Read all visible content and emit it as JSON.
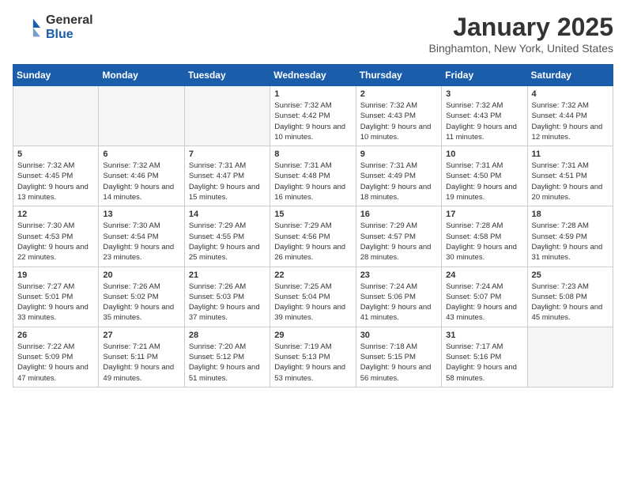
{
  "header": {
    "logo_general": "General",
    "logo_blue": "Blue",
    "title": "January 2025",
    "location": "Binghamton, New York, United States"
  },
  "weekdays": [
    "Sunday",
    "Monday",
    "Tuesday",
    "Wednesday",
    "Thursday",
    "Friday",
    "Saturday"
  ],
  "weeks": [
    [
      {
        "day": "",
        "empty": true
      },
      {
        "day": "",
        "empty": true
      },
      {
        "day": "",
        "empty": true
      },
      {
        "day": "1",
        "sunrise": "7:32 AM",
        "sunset": "4:42 PM",
        "daylight": "9 hours and 10 minutes."
      },
      {
        "day": "2",
        "sunrise": "7:32 AM",
        "sunset": "4:43 PM",
        "daylight": "9 hours and 10 minutes."
      },
      {
        "day": "3",
        "sunrise": "7:32 AM",
        "sunset": "4:43 PM",
        "daylight": "9 hours and 11 minutes."
      },
      {
        "day": "4",
        "sunrise": "7:32 AM",
        "sunset": "4:44 PM",
        "daylight": "9 hours and 12 minutes."
      }
    ],
    [
      {
        "day": "5",
        "sunrise": "7:32 AM",
        "sunset": "4:45 PM",
        "daylight": "9 hours and 13 minutes."
      },
      {
        "day": "6",
        "sunrise": "7:32 AM",
        "sunset": "4:46 PM",
        "daylight": "9 hours and 14 minutes."
      },
      {
        "day": "7",
        "sunrise": "7:31 AM",
        "sunset": "4:47 PM",
        "daylight": "9 hours and 15 minutes."
      },
      {
        "day": "8",
        "sunrise": "7:31 AM",
        "sunset": "4:48 PM",
        "daylight": "9 hours and 16 minutes."
      },
      {
        "day": "9",
        "sunrise": "7:31 AM",
        "sunset": "4:49 PM",
        "daylight": "9 hours and 18 minutes."
      },
      {
        "day": "10",
        "sunrise": "7:31 AM",
        "sunset": "4:50 PM",
        "daylight": "9 hours and 19 minutes."
      },
      {
        "day": "11",
        "sunrise": "7:31 AM",
        "sunset": "4:51 PM",
        "daylight": "9 hours and 20 minutes."
      }
    ],
    [
      {
        "day": "12",
        "sunrise": "7:30 AM",
        "sunset": "4:53 PM",
        "daylight": "9 hours and 22 minutes."
      },
      {
        "day": "13",
        "sunrise": "7:30 AM",
        "sunset": "4:54 PM",
        "daylight": "9 hours and 23 minutes."
      },
      {
        "day": "14",
        "sunrise": "7:29 AM",
        "sunset": "4:55 PM",
        "daylight": "9 hours and 25 minutes."
      },
      {
        "day": "15",
        "sunrise": "7:29 AM",
        "sunset": "4:56 PM",
        "daylight": "9 hours and 26 minutes."
      },
      {
        "day": "16",
        "sunrise": "7:29 AM",
        "sunset": "4:57 PM",
        "daylight": "9 hours and 28 minutes."
      },
      {
        "day": "17",
        "sunrise": "7:28 AM",
        "sunset": "4:58 PM",
        "daylight": "9 hours and 30 minutes."
      },
      {
        "day": "18",
        "sunrise": "7:28 AM",
        "sunset": "4:59 PM",
        "daylight": "9 hours and 31 minutes."
      }
    ],
    [
      {
        "day": "19",
        "sunrise": "7:27 AM",
        "sunset": "5:01 PM",
        "daylight": "9 hours and 33 minutes."
      },
      {
        "day": "20",
        "sunrise": "7:26 AM",
        "sunset": "5:02 PM",
        "daylight": "9 hours and 35 minutes."
      },
      {
        "day": "21",
        "sunrise": "7:26 AM",
        "sunset": "5:03 PM",
        "daylight": "9 hours and 37 minutes."
      },
      {
        "day": "22",
        "sunrise": "7:25 AM",
        "sunset": "5:04 PM",
        "daylight": "9 hours and 39 minutes."
      },
      {
        "day": "23",
        "sunrise": "7:24 AM",
        "sunset": "5:06 PM",
        "daylight": "9 hours and 41 minutes."
      },
      {
        "day": "24",
        "sunrise": "7:24 AM",
        "sunset": "5:07 PM",
        "daylight": "9 hours and 43 minutes."
      },
      {
        "day": "25",
        "sunrise": "7:23 AM",
        "sunset": "5:08 PM",
        "daylight": "9 hours and 45 minutes."
      }
    ],
    [
      {
        "day": "26",
        "sunrise": "7:22 AM",
        "sunset": "5:09 PM",
        "daylight": "9 hours and 47 minutes."
      },
      {
        "day": "27",
        "sunrise": "7:21 AM",
        "sunset": "5:11 PM",
        "daylight": "9 hours and 49 minutes."
      },
      {
        "day": "28",
        "sunrise": "7:20 AM",
        "sunset": "5:12 PM",
        "daylight": "9 hours and 51 minutes."
      },
      {
        "day": "29",
        "sunrise": "7:19 AM",
        "sunset": "5:13 PM",
        "daylight": "9 hours and 53 minutes."
      },
      {
        "day": "30",
        "sunrise": "7:18 AM",
        "sunset": "5:15 PM",
        "daylight": "9 hours and 56 minutes."
      },
      {
        "day": "31",
        "sunrise": "7:17 AM",
        "sunset": "5:16 PM",
        "daylight": "9 hours and 58 minutes."
      },
      {
        "day": "",
        "empty": true
      }
    ]
  ],
  "labels": {
    "sunrise": "Sunrise:",
    "sunset": "Sunset:",
    "daylight": "Daylight:"
  }
}
